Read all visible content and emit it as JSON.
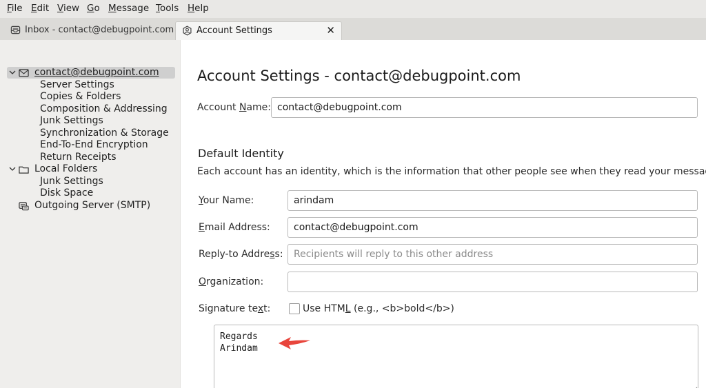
{
  "menu": [
    {
      "key": "F",
      "rest": "ile"
    },
    {
      "key": "E",
      "rest": "dit"
    },
    {
      "key": "V",
      "rest": "iew"
    },
    {
      "key": "G",
      "rest": "o"
    },
    {
      "key": "M",
      "rest": "essage"
    },
    {
      "key": "T",
      "rest": "ools"
    },
    {
      "key": "H",
      "rest": "elp"
    }
  ],
  "tabs": {
    "inbox": {
      "label": "Inbox - contact@debugpoint.com",
      "icon": "inbox-icon"
    },
    "settings": {
      "label": "Account Settings",
      "icon": "settings-icon",
      "close": "✕"
    }
  },
  "sidebar": {
    "account": {
      "label": "contact@debugpoint.com",
      "icon": "mail-account-icon"
    },
    "account_items": [
      "Server Settings",
      "Copies & Folders",
      "Composition & Addressing",
      "Junk Settings",
      "Synchronization & Storage",
      "End-To-End Encryption",
      "Return Receipts"
    ],
    "local": {
      "label": "Local Folders",
      "icon": "folder-icon"
    },
    "local_items": [
      "Junk Settings",
      "Disk Space"
    ],
    "smtp": {
      "label": "Outgoing Server (SMTP)",
      "icon": "outgoing-server-icon"
    }
  },
  "main": {
    "title": "Account Settings - contact@debugpoint.com",
    "account_name": {
      "pre": "Account ",
      "key": "N",
      "post": "ame:",
      "value": "contact@debugpoint.com"
    },
    "default_identity": "Default Identity",
    "description": "Each account has an identity, which is the information that other people see when they read your messages.",
    "your_name": {
      "key": "Y",
      "post": "our Name:",
      "value": "arindam"
    },
    "email": {
      "key": "E",
      "post": "mail Address:",
      "value": "contact@debugpoint.com"
    },
    "reply_to": {
      "pre": "Reply-to Addre",
      "key": "s",
      "post": "s:",
      "placeholder": "Recipients will reply to this other address"
    },
    "organization": {
      "key": "O",
      "post": "rganization:",
      "value": ""
    },
    "signature": {
      "pre": "Signature te",
      "key": "x",
      "post": "t:",
      "html_pre": "Use HTM",
      "html_key": "L",
      "html_post": " (e.g., <b>bold</b>)",
      "text": "Regards\nArindam"
    },
    "accent": "#e8453c"
  }
}
